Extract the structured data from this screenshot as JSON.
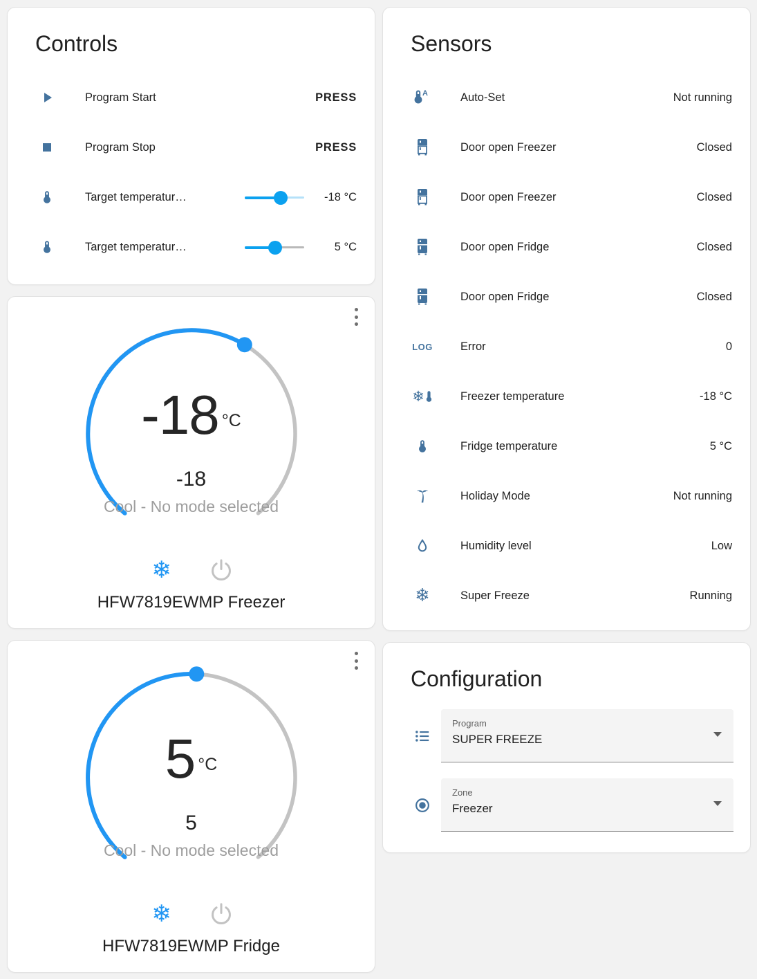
{
  "colors": {
    "accent_blue": "#03a9f4",
    "icon_blue": "#44739e",
    "dial_active": "#2196f3",
    "dial_inactive": "#c3c3c3",
    "text_primary": "#212121",
    "text_secondary": "#9e9e9e"
  },
  "glyphs": {
    "snowflake": "❄"
  },
  "controls": {
    "title": "Controls",
    "rows": [
      {
        "icon": "play-icon",
        "name": "Program Start",
        "action": "PRESS"
      },
      {
        "icon": "stop-icon",
        "name": "Program Stop",
        "action": "PRESS"
      },
      {
        "icon": "thermometer-icon",
        "name": "Target temperatur…",
        "value": "-18 °C",
        "slider_pct": 60
      },
      {
        "icon": "thermometer-icon",
        "name": "Target temperatur…",
        "value": "5 °C",
        "slider_pct": 51
      }
    ]
  },
  "thermostats": [
    {
      "big": "-18",
      "unit": "°C",
      "current": "-18",
      "mode": "Cool - No mode selected",
      "name": "HFW7819EWMP Freezer",
      "arc_fraction": 0.61
    },
    {
      "big": "5",
      "unit": "°C",
      "current": "5",
      "mode": "Cool - No mode selected",
      "name": "HFW7819EWMP Fridge",
      "arc_fraction": 0.51
    }
  ],
  "sensors": {
    "title": "Sensors",
    "rows": [
      {
        "icon": "thermometer-auto-icon",
        "name": "Auto-Set",
        "value": "Not running"
      },
      {
        "icon": "fridge-top-icon",
        "name": "Door open Freezer",
        "value": "Closed"
      },
      {
        "icon": "fridge-top-icon",
        "name": "Door open Freezer",
        "value": "Closed"
      },
      {
        "icon": "fridge-bottom-icon",
        "name": "Door open Fridge",
        "value": "Closed"
      },
      {
        "icon": "fridge-bottom-icon",
        "name": "Door open Fridge",
        "value": "Closed"
      },
      {
        "icon": "log-icon",
        "icon_text": "LOG",
        "name": "Error",
        "value": "0"
      },
      {
        "icon": "snowflake-thermometer-icon",
        "name": "Freezer temperature",
        "value": "-18 °C"
      },
      {
        "icon": "thermometer-icon",
        "name": "Fridge temperature",
        "value": "5 °C"
      },
      {
        "icon": "palm-tree-icon",
        "name": "Holiday Mode",
        "value": "Not running"
      },
      {
        "icon": "water-drop-icon",
        "name": "Humidity level",
        "value": "Low"
      },
      {
        "icon": "snowflake-icon",
        "name": "Super Freeze",
        "value": "Running"
      }
    ]
  },
  "configuration": {
    "title": "Configuration",
    "fields": [
      {
        "icon": "format-list-icon",
        "label": "Program",
        "value": "SUPER FREEZE"
      },
      {
        "icon": "radiobox-icon",
        "label": "Zone",
        "value": "Freezer"
      }
    ]
  }
}
